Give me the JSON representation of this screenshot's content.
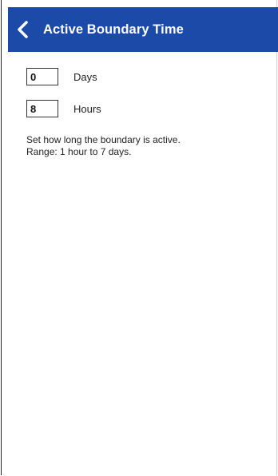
{
  "header": {
    "title": "Active Boundary Time",
    "back_icon": "chevron-left-icon",
    "background_color": "#1b4aa8"
  },
  "fields": {
    "days": {
      "value": "0",
      "label": "Days"
    },
    "hours": {
      "value": "8",
      "label": "Hours"
    }
  },
  "help": {
    "line1": "Set how long the boundary is active.",
    "line2": "Range: 1 hour to 7 days."
  }
}
